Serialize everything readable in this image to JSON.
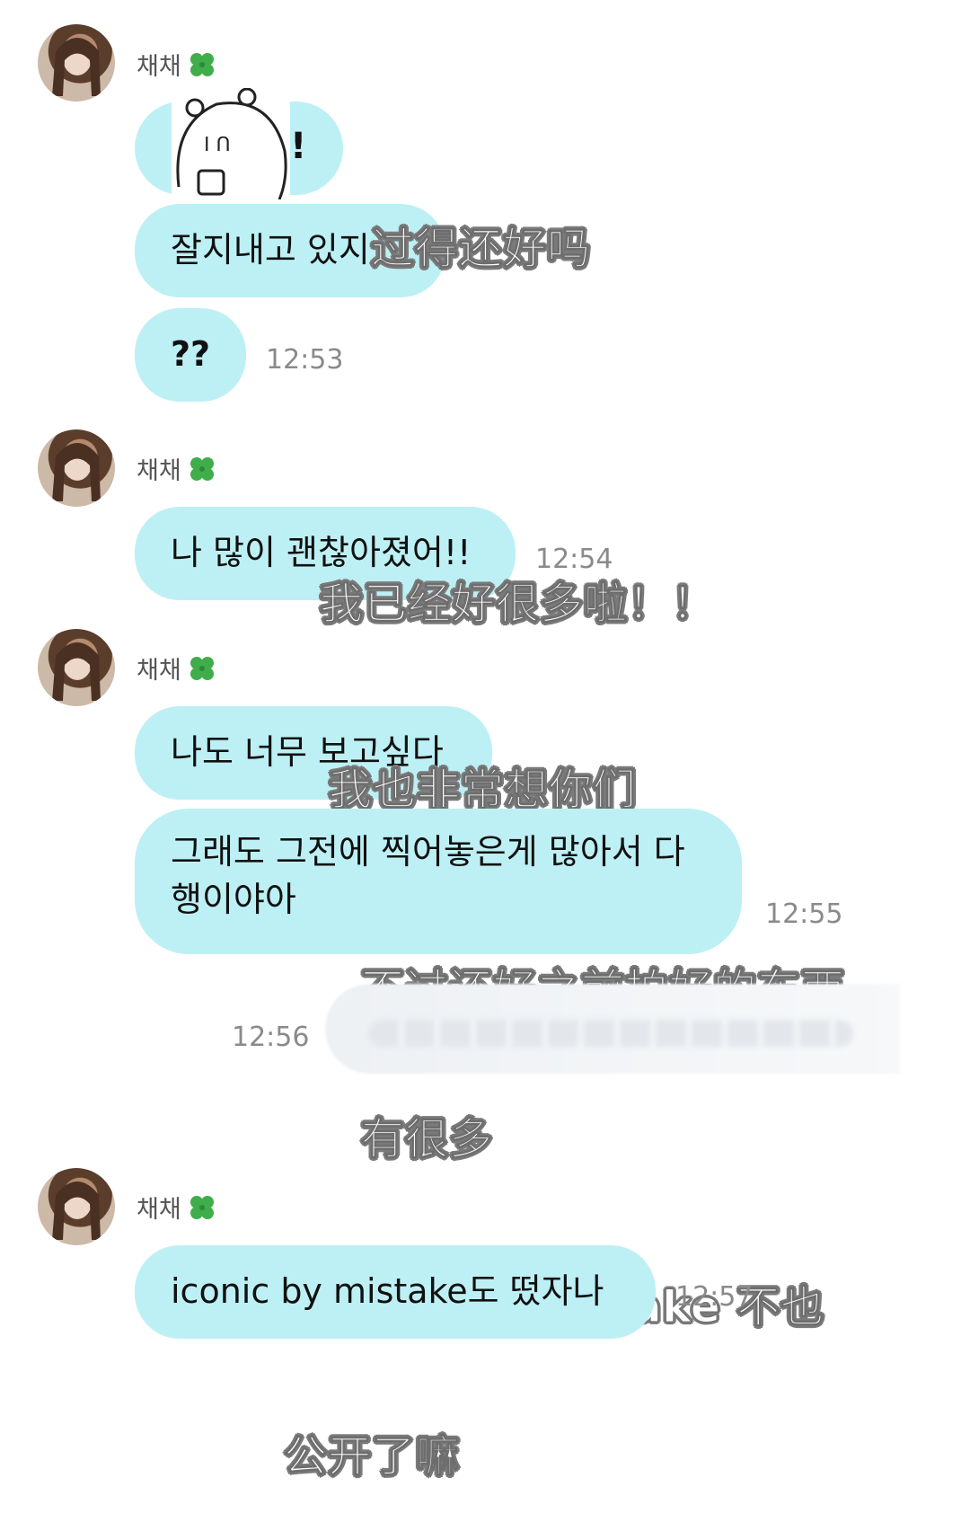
{
  "sender_name": "채채",
  "groups": [
    {
      "messages": [
        {
          "text": "잘지내고 있지",
          "note": "sticker-then-text"
        },
        {
          "text": "??",
          "time": "12:53"
        }
      ],
      "sticker_text": "!"
    },
    {
      "messages": [
        {
          "text": "나 많이 괜찮아졌어!!",
          "time": "12:54"
        }
      ]
    },
    {
      "messages": [
        {
          "text": "나도 너무 보고싶다"
        },
        {
          "line1": "그래도 그전에 찍어놓은게 많아서 다",
          "line2": "행이야아",
          "time": "12:55"
        }
      ]
    },
    {
      "messages": [
        {
          "text": "iconic by mistake도 떴자나",
          "time": "12:57"
        }
      ]
    }
  ],
  "outgoing": {
    "time": "12:56"
  },
  "captions": {
    "c1": "过得还好吗",
    "c2": "我已经好很多啦！！",
    "c3": "我也非常想你们",
    "c4_line1": "不过还好之前拍好的东西",
    "c4_line2": "有很多",
    "c5_line1": "iconic by mistake 不也",
    "c5_line2": "公开了嘛"
  },
  "colors": {
    "bubble": "#bdf0f4",
    "time": "#8a8a8a",
    "caption_fill": "#ffffff",
    "caption_outline": "#7a7a7a"
  },
  "icons": [
    "four-leaf-clover-icon",
    "avatar"
  ]
}
